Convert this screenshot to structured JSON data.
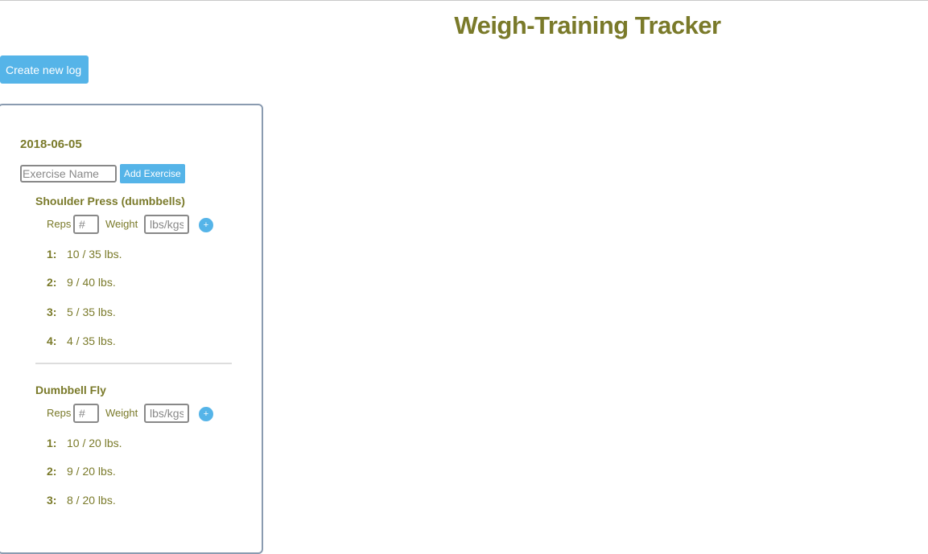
{
  "header": {
    "title": "Weigh-Training Tracker"
  },
  "toolbar": {
    "create_log_label": "Create new log"
  },
  "log": {
    "date": "2018-06-05",
    "exercise_input": {
      "placeholder": "Exercise Name",
      "value": ""
    },
    "add_exercise_label": "Add Exercise",
    "exercises": [
      {
        "name": "Shoulder Press (dumbbells)",
        "reps_label": "Reps",
        "reps_placeholder": "#",
        "weight_label": "Weight",
        "weight_placeholder": "lbs/kgs",
        "add_set_label": "+",
        "sets": [
          {
            "num": "1:",
            "value": "10 / 35 lbs."
          },
          {
            "num": "2:",
            "value": "9 / 40 lbs."
          },
          {
            "num": "3:",
            "value": "5 / 35 lbs."
          },
          {
            "num": "4:",
            "value": "4 / 35 lbs."
          }
        ]
      },
      {
        "name": "Dumbbell Fly",
        "reps_label": "Reps",
        "reps_placeholder": "#",
        "weight_label": "Weight",
        "weight_placeholder": "lbs/kgs",
        "add_set_label": "+",
        "sets": [
          {
            "num": "1:",
            "value": "10 / 20 lbs."
          },
          {
            "num": "2:",
            "value": "9 / 20 lbs."
          },
          {
            "num": "3:",
            "value": "8 / 20 lbs."
          }
        ]
      }
    ]
  },
  "colors": {
    "accent": "#55b4e8",
    "text": "#7a7a2a",
    "panel_border": "#8a9bb0"
  }
}
